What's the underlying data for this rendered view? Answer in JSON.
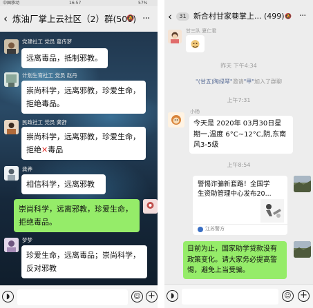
{
  "left_chat": {
    "status_bar": {
      "carrier": "中国移动",
      "time": "16:57",
      "battery": "57%"
    },
    "header": {
      "back_icon": "back-arrow-icon",
      "title": "炼油厂掌上云社区（2）群(500)",
      "mute_icon": "mute-bell-icon",
      "more_icon": "more-dots-icon"
    },
    "messages": [
      {
        "sender": "党建社工 党员 葛传梦",
        "text": "远离毒品，抵制邪教。"
      },
      {
        "sender": "计划生育社工 党员 赵丹",
        "lines": [
          "崇尚科学，远离邪教，珍爱生命，",
          "拒绝毒品。"
        ]
      },
      {
        "sender": "民政社工 党员 龚舒",
        "lines": [
          "崇尚科学，远离邪教，珍爱生命，"
        ],
        "last_before": "拒绝",
        "x_symbol": "✕",
        "last_after": "毒品"
      },
      {
        "sender": "龚莽",
        "text": "相信科学，远离邪教"
      },
      {
        "sender": "",
        "self": true,
        "lines": [
          "崇尚科学，远离邪教，珍爱生命，",
          "拒绝毒品。"
        ]
      },
      {
        "sender": "梦梦",
        "lines": [
          "珍爱生命，远离毒品；崇尚科学，",
          "反对邪教"
        ]
      }
    ],
    "input_bar": {
      "voice_icon": "voice-icon",
      "emoji_icon": "emoji-icon",
      "plus_icon": "plus-icon"
    }
  },
  "right_chat": {
    "header": {
      "back_icon": "back-arrow-icon",
      "unread_count": "31",
      "title": "新合村甘家巷掌上...",
      "member_count": "(499)",
      "mute_icon": "mute-bell-icon",
      "more_icon": "more-dots-icon"
    },
    "first_message": {
      "sender": "甘三队 夏仁君"
    },
    "timestamp_1": "昨天 下午4:34",
    "system_message": {
      "inviter": "\"(甘五)陶绿琴\"",
      "mid": "邀请",
      "invitee": "\"甲\"",
      "tail": "加入了群聊"
    },
    "timestamp_2": "上午7:31",
    "weather_message": {
      "sender": "小杨",
      "lines": [
        "今天是 2020年 03月30日星",
        "期一,温度 6°C~12°C,阴,东南",
        "风3-5级"
      ]
    },
    "timestamp_3": "上午8:54",
    "link_card": {
      "title_lines": [
        "警惕诈骗新套路！全国学",
        "生资助管理中心发布20..."
      ],
      "source": "江苏警方"
    },
    "self_message": {
      "lines": [
        "目前为止，国家助学贷款没有",
        "政策变化。请大家务必提高警",
        "惕，避免上当受骗。"
      ]
    },
    "input_bar": {
      "voice_icon": "voice-icon",
      "emoji_icon": "emoji-icon",
      "plus_icon": "plus-icon"
    }
  }
}
